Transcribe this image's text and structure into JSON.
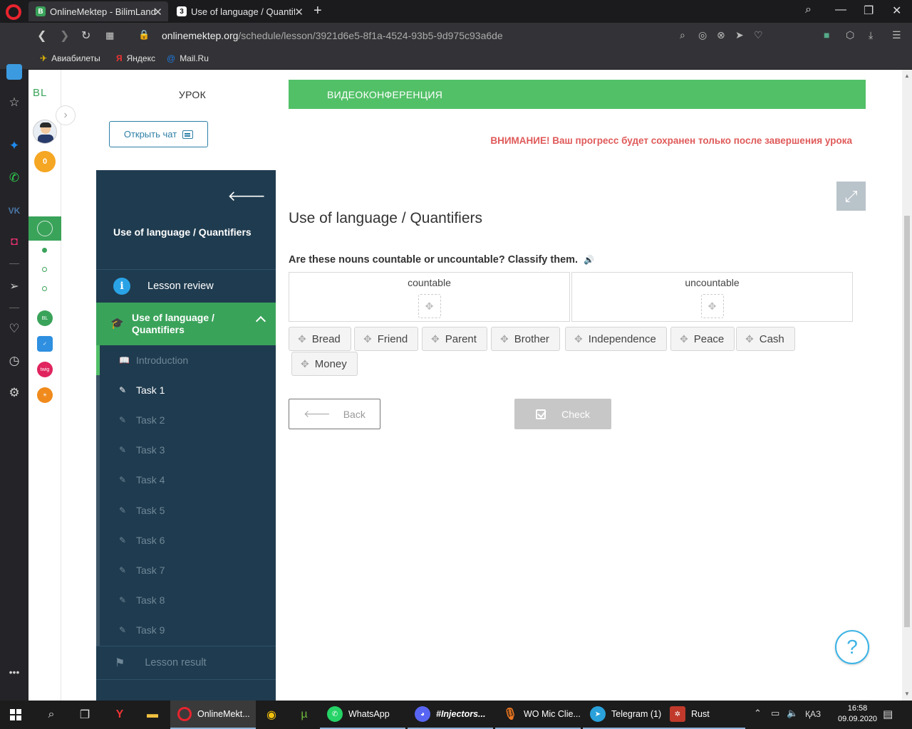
{
  "browser": {
    "tabs": [
      {
        "title": "OnlineMektep - BilimLand",
        "active": true
      },
      {
        "title": "Use of language / Quantifie",
        "active": false
      }
    ],
    "url_domain": "onlinemektep.org",
    "url_path": "/schedule/lesson/3921d6e5-8f1a-4524-93b5-9d975c93a6de",
    "bookmarks": [
      "Авиабилеты",
      "Яндекс",
      "Mail.Ru"
    ]
  },
  "site": {
    "logo": "BL",
    "coins": "0",
    "tab_lesson": "УРОК",
    "tab_video": "ВИДЕОКОНФЕРЕНЦИЯ",
    "open_chat": "Открыть чат",
    "warning": "ВНИМАНИЕ! Ваш прогресс будет сохранен только после завершения урока"
  },
  "nav": {
    "title": "Use of language / Quantifiers",
    "review": "Lesson review",
    "section": "Use of language / Quantifiers",
    "items": [
      "Introduction",
      "Task 1",
      "Task 2",
      "Task 3",
      "Task 4",
      "Task 5",
      "Task 6",
      "Task 7",
      "Task 8",
      "Task 9"
    ],
    "current_item": "Task 1",
    "result": "Lesson result"
  },
  "content": {
    "heading": "Use of language / Quantifiers",
    "question": "Are these nouns countable or uncountable? Classify them.",
    "categories": [
      "countable",
      "uncountable"
    ],
    "words": [
      "Bread",
      "Friend",
      "Parent",
      "Brother",
      "Independence",
      "Peace",
      "Cash",
      "Money"
    ],
    "back": "Back",
    "check": "Check",
    "help": "?"
  },
  "taskbar": {
    "apps": [
      "OnlineMekt...",
      "WhatsApp",
      "#Injectors...",
      "WO Mic Clie...",
      "Telegram (1)",
      "Rust"
    ],
    "lang": "ҚАЗ",
    "time": "16:58",
    "date": "09.09.2020"
  },
  "colors": {
    "green": "#52c067",
    "nav_bg": "#1f3b4f",
    "warning": "#e05a5a",
    "link_blue": "#2e7fa6"
  }
}
